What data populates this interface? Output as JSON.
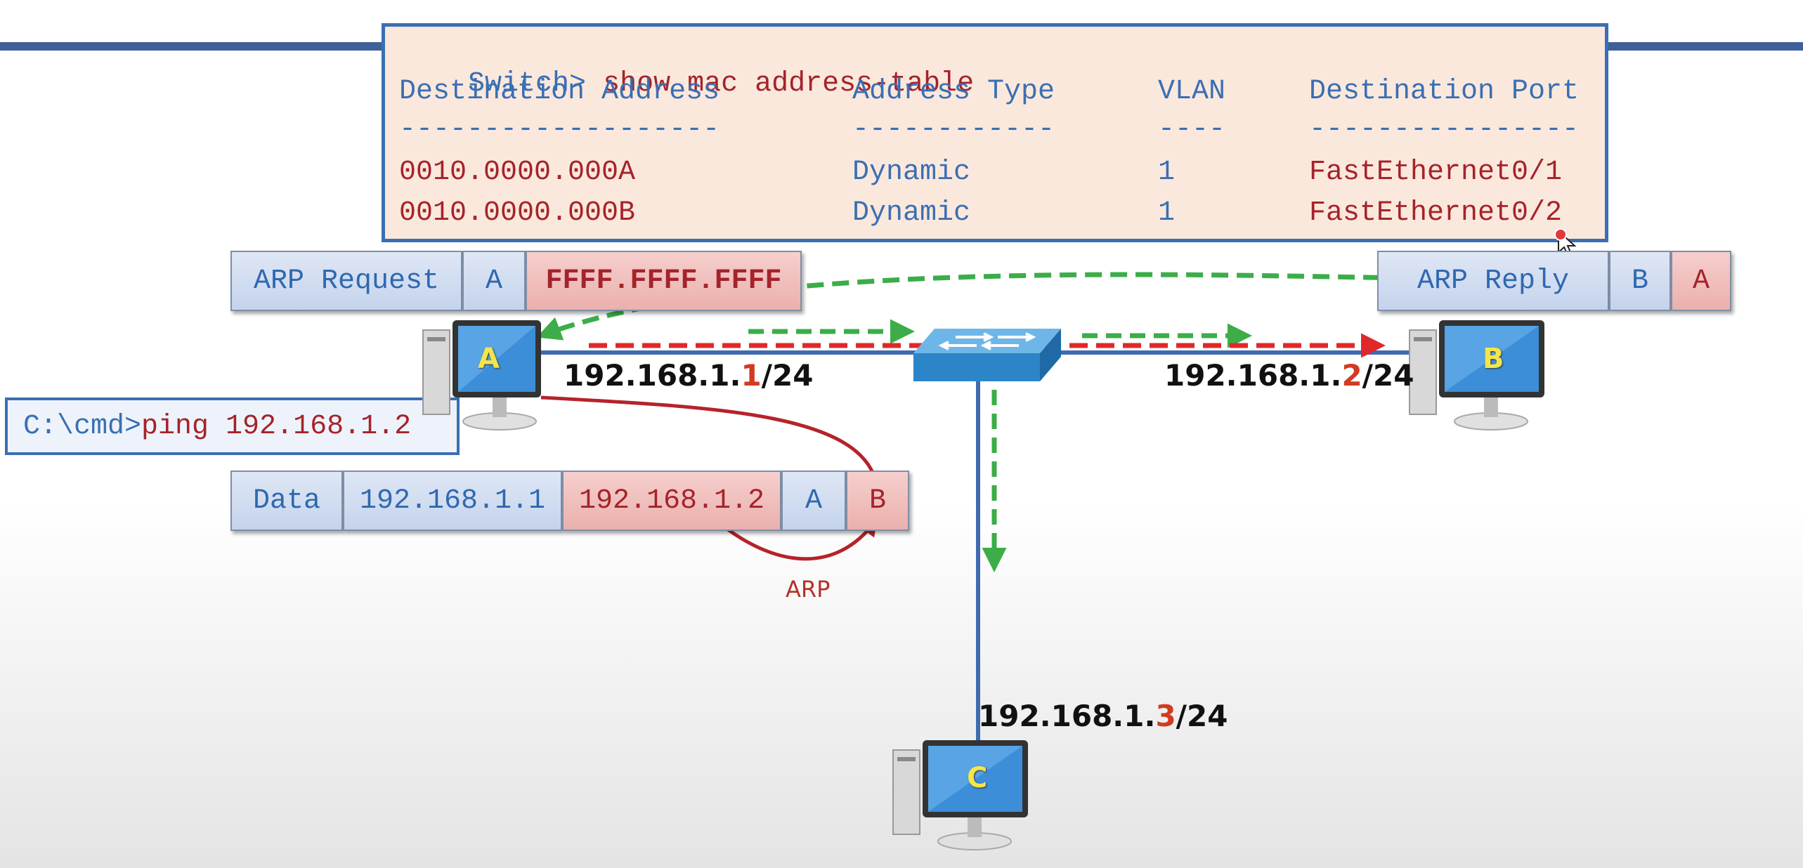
{
  "terminal": {
    "prompt": "Switch>",
    "command": "show mac address-table",
    "headers": [
      "Destination Address",
      "Address Type",
      "VLAN",
      "Destination Port"
    ],
    "dashes": [
      "-------------------",
      "------------",
      "----",
      "----------------"
    ],
    "rows": [
      {
        "address": "0010.0000.000A",
        "type": "Dynamic",
        "vlan": "1",
        "port": "FastEthernet0/1"
      },
      {
        "address": "0010.0000.000B",
        "type": "Dynamic",
        "vlan": "1",
        "port": "FastEthernet0/2"
      }
    ]
  },
  "arp_request": {
    "label": "ARP Request",
    "src": "A",
    "dst": "FFFF.FFFF.FFFF"
  },
  "arp_reply": {
    "label": "ARP Reply",
    "src": "B",
    "dst": "A"
  },
  "cmd": {
    "prompt": "C:\\cmd>",
    "command": "ping 192.168.1.2"
  },
  "data_frame": {
    "label": "Data",
    "src_ip": "192.168.1.1",
    "dst_ip": "192.168.1.2",
    "src_mac": "A",
    "dst_mac": "B"
  },
  "arp_label": "ARP",
  "hosts": {
    "a": {
      "name": "A",
      "ip_prefix": "192.168.1.",
      "ip_octet": "1",
      "ip_suffix": "/24"
    },
    "b": {
      "name": "B",
      "ip_prefix": "192.168.1.",
      "ip_octet": "2",
      "ip_suffix": "/24"
    },
    "c": {
      "name": "C",
      "ip_prefix": "192.168.1.",
      "ip_octet": "3",
      "ip_suffix": "/24"
    }
  },
  "colors": {
    "blue": "#3a6fb3",
    "red": "#a5232a",
    "green_arrow": "#3cad48",
    "red_arrow": "#e02828",
    "panel": "#fbe8dc"
  }
}
